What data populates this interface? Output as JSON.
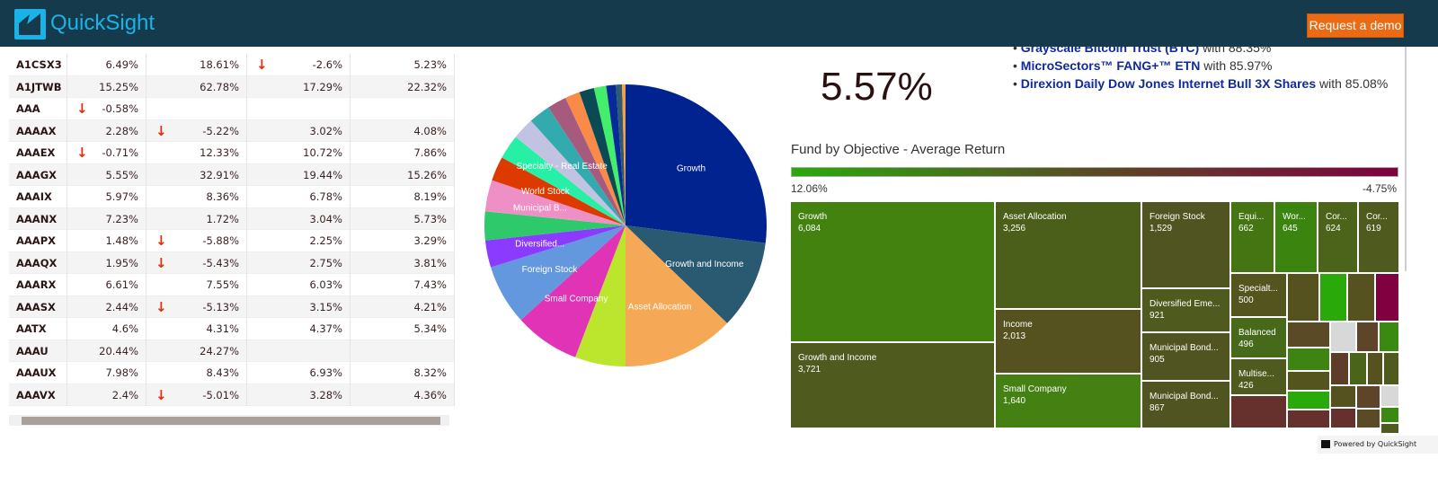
{
  "header": {
    "brand": "QuickSight",
    "demo_label": "Request a demo"
  },
  "table": {
    "rows": [
      [
        "A1CSX3",
        "6.49%",
        "18.61%",
        "-2.6%",
        "5.23%"
      ],
      [
        "A1JTWB",
        "15.25%",
        "62.78%",
        "17.29%",
        "22.32%"
      ],
      [
        "AAA",
        "-0.58%",
        "",
        "",
        ""
      ],
      [
        "AAAAX",
        "2.28%",
        "-5.22%",
        "3.02%",
        "4.08%"
      ],
      [
        "AAAEX",
        "-0.71%",
        "12.33%",
        "10.72%",
        "7.86%"
      ],
      [
        "AAAGX",
        "5.55%",
        "32.91%",
        "19.44%",
        "15.26%"
      ],
      [
        "AAAIX",
        "5.97%",
        "8.36%",
        "6.78%",
        "8.19%"
      ],
      [
        "AAANX",
        "7.23%",
        "1.72%",
        "3.04%",
        "5.73%"
      ],
      [
        "AAAPX",
        "1.48%",
        "-5.88%",
        "2.25%",
        "3.29%"
      ],
      [
        "AAAQX",
        "1.95%",
        "-5.43%",
        "2.75%",
        "3.81%"
      ],
      [
        "AAARX",
        "6.61%",
        "7.55%",
        "6.03%",
        "7.43%"
      ],
      [
        "AAASX",
        "2.44%",
        "-5.13%",
        "3.15%",
        "4.21%"
      ],
      [
        "AATX",
        "4.6%",
        "4.31%",
        "4.37%",
        "5.34%"
      ],
      [
        "AAAU",
        "20.44%",
        "24.27%",
        "",
        ""
      ],
      [
        "AAAUX",
        "7.98%",
        "8.43%",
        "6.93%",
        "8.32%"
      ],
      [
        "AAAVX",
        "2.4%",
        "-5.01%",
        "3.28%",
        "4.36%"
      ]
    ],
    "down_icon": "arrow-down-icon",
    "down_color": "#e03010"
  },
  "kpi": {
    "value": "5.57%"
  },
  "top_funds": [
    {
      "name": "Grayscale Bitcoin Trust (BTC)",
      "suffix": " with 88.35%"
    },
    {
      "name": "MicroSectors™ FANG+™ ETN",
      "suffix": " with 85.97%"
    },
    {
      "name": "Direxion Daily Dow Jones Internet Bull 3X Shares",
      "suffix": " with 85.08%"
    }
  ],
  "chart_data": {
    "type": "pie",
    "slices": [
      {
        "label": "Growth",
        "share": 27.0,
        "color": "#00238f"
      },
      {
        "label": "Growth and Income",
        "share": 10.2,
        "color": "#2a5a72"
      },
      {
        "label": "Asset Allocation",
        "share": 12.8,
        "color": "#f5a855"
      },
      {
        "label": "",
        "share": 5.8,
        "color": "#bce52e"
      },
      {
        "label": "Small Company",
        "share": 7.5,
        "color": "#e033b6"
      },
      {
        "label": "Foreign Stock",
        "share": 6.9,
        "color": "#6398df"
      },
      {
        "label": "Diversified...",
        "share": 3.1,
        "color": "#8a3bff"
      },
      {
        "label": "",
        "share": 3.3,
        "color": "#2ec96a"
      },
      {
        "label": "Municipal B...",
        "share": 3.6,
        "color": "#ee90c6"
      },
      {
        "label": "World Stock",
        "share": 2.8,
        "color": "#dd3a00"
      },
      {
        "label": "",
        "share": 2.8,
        "color": "#27f0a6"
      },
      {
        "label": "Specialty - Real Estate",
        "share": 2.5,
        "color": "#c2c3e2"
      },
      {
        "label": "",
        "share": 2.5,
        "color": "#33aaae"
      },
      {
        "label": "",
        "share": 2.2,
        "color": "#a55a7e"
      },
      {
        "label": "",
        "share": 1.7,
        "color": "#f98a47"
      },
      {
        "label": "",
        "share": 1.7,
        "color": "#0a4a55"
      },
      {
        "label": "",
        "share": 1.4,
        "color": "#42ee6a"
      },
      {
        "label": "",
        "share": 1.1,
        "color": "#072a9a"
      },
      {
        "label": "",
        "share": 0.7,
        "color": "#305a70"
      },
      {
        "label": "",
        "share": 0.4,
        "color": "#f3a04e"
      }
    ]
  },
  "treemap": {
    "title": "Fund by Objective - Average Return",
    "legend_max": "12.06%",
    "legend_min": "-4.75%",
    "gradient": [
      "#2aaa0a",
      "#5a4a25",
      "#800040"
    ],
    "cells": [
      {
        "name": "Growth",
        "value": "6,084",
        "color": "#44820f"
      },
      {
        "name": "Growth and Income",
        "value": "3,721",
        "color": "#4f5a1e"
      },
      {
        "name": "Asset Allocation",
        "value": "3,256",
        "color": "#4c5f1a"
      },
      {
        "name": "Income",
        "value": "2,013",
        "color": "#56521f"
      },
      {
        "name": "Small Company",
        "value": "1,640",
        "color": "#458012"
      },
      {
        "name": "Foreign Stock",
        "value": "1,529",
        "color": "#505420"
      },
      {
        "name": "Diversified Eme...",
        "value": "921",
        "color": "#4f5a1e"
      },
      {
        "name": "Municipal Bond...",
        "value": "905",
        "color": "#505420"
      },
      {
        "name": "Municipal Bond...",
        "value": "867",
        "color": "#505420"
      },
      {
        "name": "Equi...",
        "value": "662",
        "color": "#457512"
      },
      {
        "name": "Wor...",
        "value": "645",
        "color": "#3c8410"
      },
      {
        "name": "Cor...",
        "value": "624",
        "color": "#4c6419"
      },
      {
        "name": "Cor...",
        "value": "619",
        "color": "#4f5a1e"
      },
      {
        "name": "Specialt...",
        "value": "500",
        "color": "#54541f"
      },
      {
        "name": "Balanced",
        "value": "496",
        "color": "#46691a"
      },
      {
        "name": "Multise...",
        "value": "426",
        "color": "#4f5a1e"
      },
      {
        "name": "",
        "value": "",
        "color": "#66302d"
      },
      {
        "name": "",
        "value": "",
        "color": "#56521f"
      },
      {
        "name": "",
        "value": "",
        "color": "#2aaa0a"
      },
      {
        "name": "",
        "value": "",
        "color": "#56521f"
      },
      {
        "name": "",
        "value": "",
        "color": "#800040"
      },
      {
        "name": "",
        "value": "",
        "color": "#5a4a25"
      },
      {
        "name": "",
        "value": "",
        "color": "#d8d8d8"
      },
      {
        "name": "",
        "value": "",
        "color": "#5e4428"
      },
      {
        "name": "",
        "value": "",
        "color": "#3a8a12"
      },
      {
        "name": "",
        "value": "",
        "color": "#3d8412"
      },
      {
        "name": "",
        "value": "",
        "color": "#54541f"
      },
      {
        "name": "",
        "value": "",
        "color": "#2aaa0a"
      },
      {
        "name": "",
        "value": "",
        "color": "#66302d"
      },
      {
        "name": "",
        "value": "",
        "color": "#5e3c2a"
      },
      {
        "name": "",
        "value": "",
        "color": "#4a6419"
      },
      {
        "name": "",
        "value": "",
        "color": "#56521f"
      },
      {
        "name": "",
        "value": "",
        "color": "#4f5a1e"
      },
      {
        "name": "",
        "value": "",
        "color": "#56521f"
      },
      {
        "name": "",
        "value": "",
        "color": "#5e4428"
      },
      {
        "name": "",
        "value": "",
        "color": "#d8d8d8"
      },
      {
        "name": "",
        "value": "",
        "color": "#66302d"
      },
      {
        "name": "",
        "value": "",
        "color": "#5a4a25"
      },
      {
        "name": "",
        "value": "",
        "color": "#3a8a12"
      },
      {
        "name": "",
        "value": "",
        "color": "#4f5a1e"
      }
    ]
  },
  "footer": {
    "powered": "Powered by QuickSight"
  }
}
